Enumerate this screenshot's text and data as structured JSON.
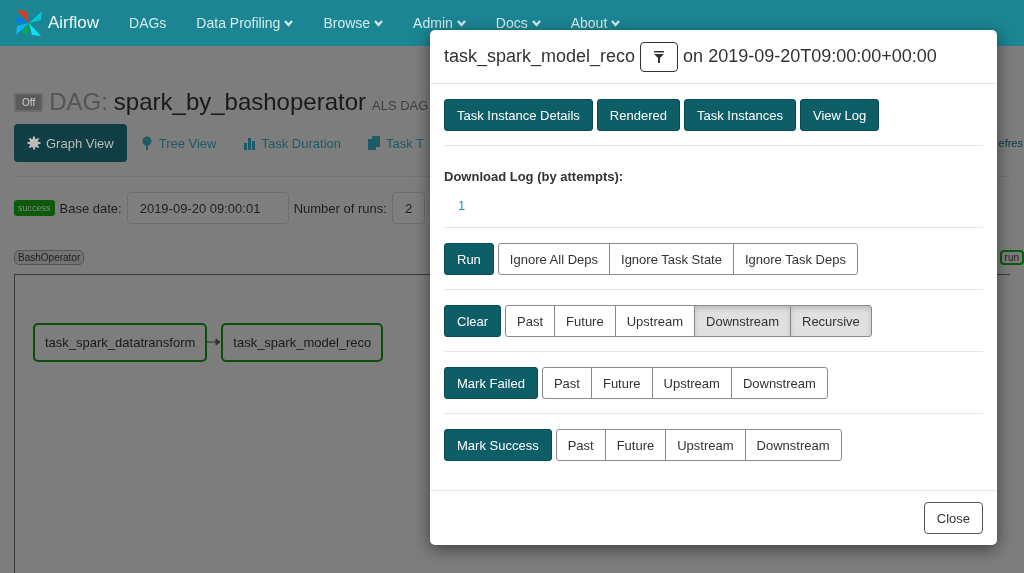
{
  "navbar": {
    "brand": "Airflow",
    "items": [
      {
        "label": "DAGs",
        "dropdown": false
      },
      {
        "label": "Data Profiling",
        "dropdown": true
      },
      {
        "label": "Browse",
        "dropdown": true
      },
      {
        "label": "Admin",
        "dropdown": true
      },
      {
        "label": "Docs",
        "dropdown": true
      },
      {
        "label": "About",
        "dropdown": true
      }
    ]
  },
  "dag_header": {
    "toggle": "Off",
    "prefix": "DAG:",
    "dag_id": "spark_by_bashoperator",
    "description": "ALS DAG"
  },
  "view_tabs": [
    {
      "label": "Graph View",
      "selected": true
    },
    {
      "label": "Tree View",
      "selected": false
    },
    {
      "label": "Task Duration",
      "selected": false
    },
    {
      "label": "Task T",
      "selected": false
    }
  ],
  "refresh_link": "efres",
  "controls": {
    "state_badge": "success",
    "base_date_label": "Base date:",
    "base_date": "2019-09-20 09:00:01",
    "runs_label": "Number of runs:",
    "runs": "2"
  },
  "operator_legend": [
    "BashOperator"
  ],
  "state_legend": [
    "run"
  ],
  "graph": {
    "nodes": [
      {
        "label": "task_spark_datatransform"
      },
      {
        "label": "task_spark_model_reco"
      }
    ]
  },
  "modal": {
    "task_id": "task_spark_model_reco",
    "date_text": "on 2019-09-20T09:00:00+00:00",
    "links": [
      "Task Instance Details",
      "Rendered",
      "Task Instances",
      "View Log"
    ],
    "download_label": "Download Log (by attempts):",
    "attempts": [
      "1"
    ],
    "actions": [
      {
        "label": "Run",
        "options": [
          {
            "label": "Ignore All Deps",
            "selected": false
          },
          {
            "label": "Ignore Task State",
            "selected": false
          },
          {
            "label": "Ignore Task Deps",
            "selected": false
          }
        ]
      },
      {
        "label": "Clear",
        "options": [
          {
            "label": "Past",
            "selected": false
          },
          {
            "label": "Future",
            "selected": false
          },
          {
            "label": "Upstream",
            "selected": false
          },
          {
            "label": "Downstream",
            "selected": true
          },
          {
            "label": "Recursive",
            "selected": true
          }
        ]
      },
      {
        "label": "Mark Failed",
        "options": [
          {
            "label": "Past",
            "selected": false
          },
          {
            "label": "Future",
            "selected": false
          },
          {
            "label": "Upstream",
            "selected": false
          },
          {
            "label": "Downstream",
            "selected": false
          }
        ]
      },
      {
        "label": "Mark Success",
        "options": [
          {
            "label": "Past",
            "selected": false
          },
          {
            "label": "Future",
            "selected": false
          },
          {
            "label": "Upstream",
            "selected": false
          },
          {
            "label": "Downstream",
            "selected": false
          }
        ]
      }
    ],
    "close": "Close"
  }
}
